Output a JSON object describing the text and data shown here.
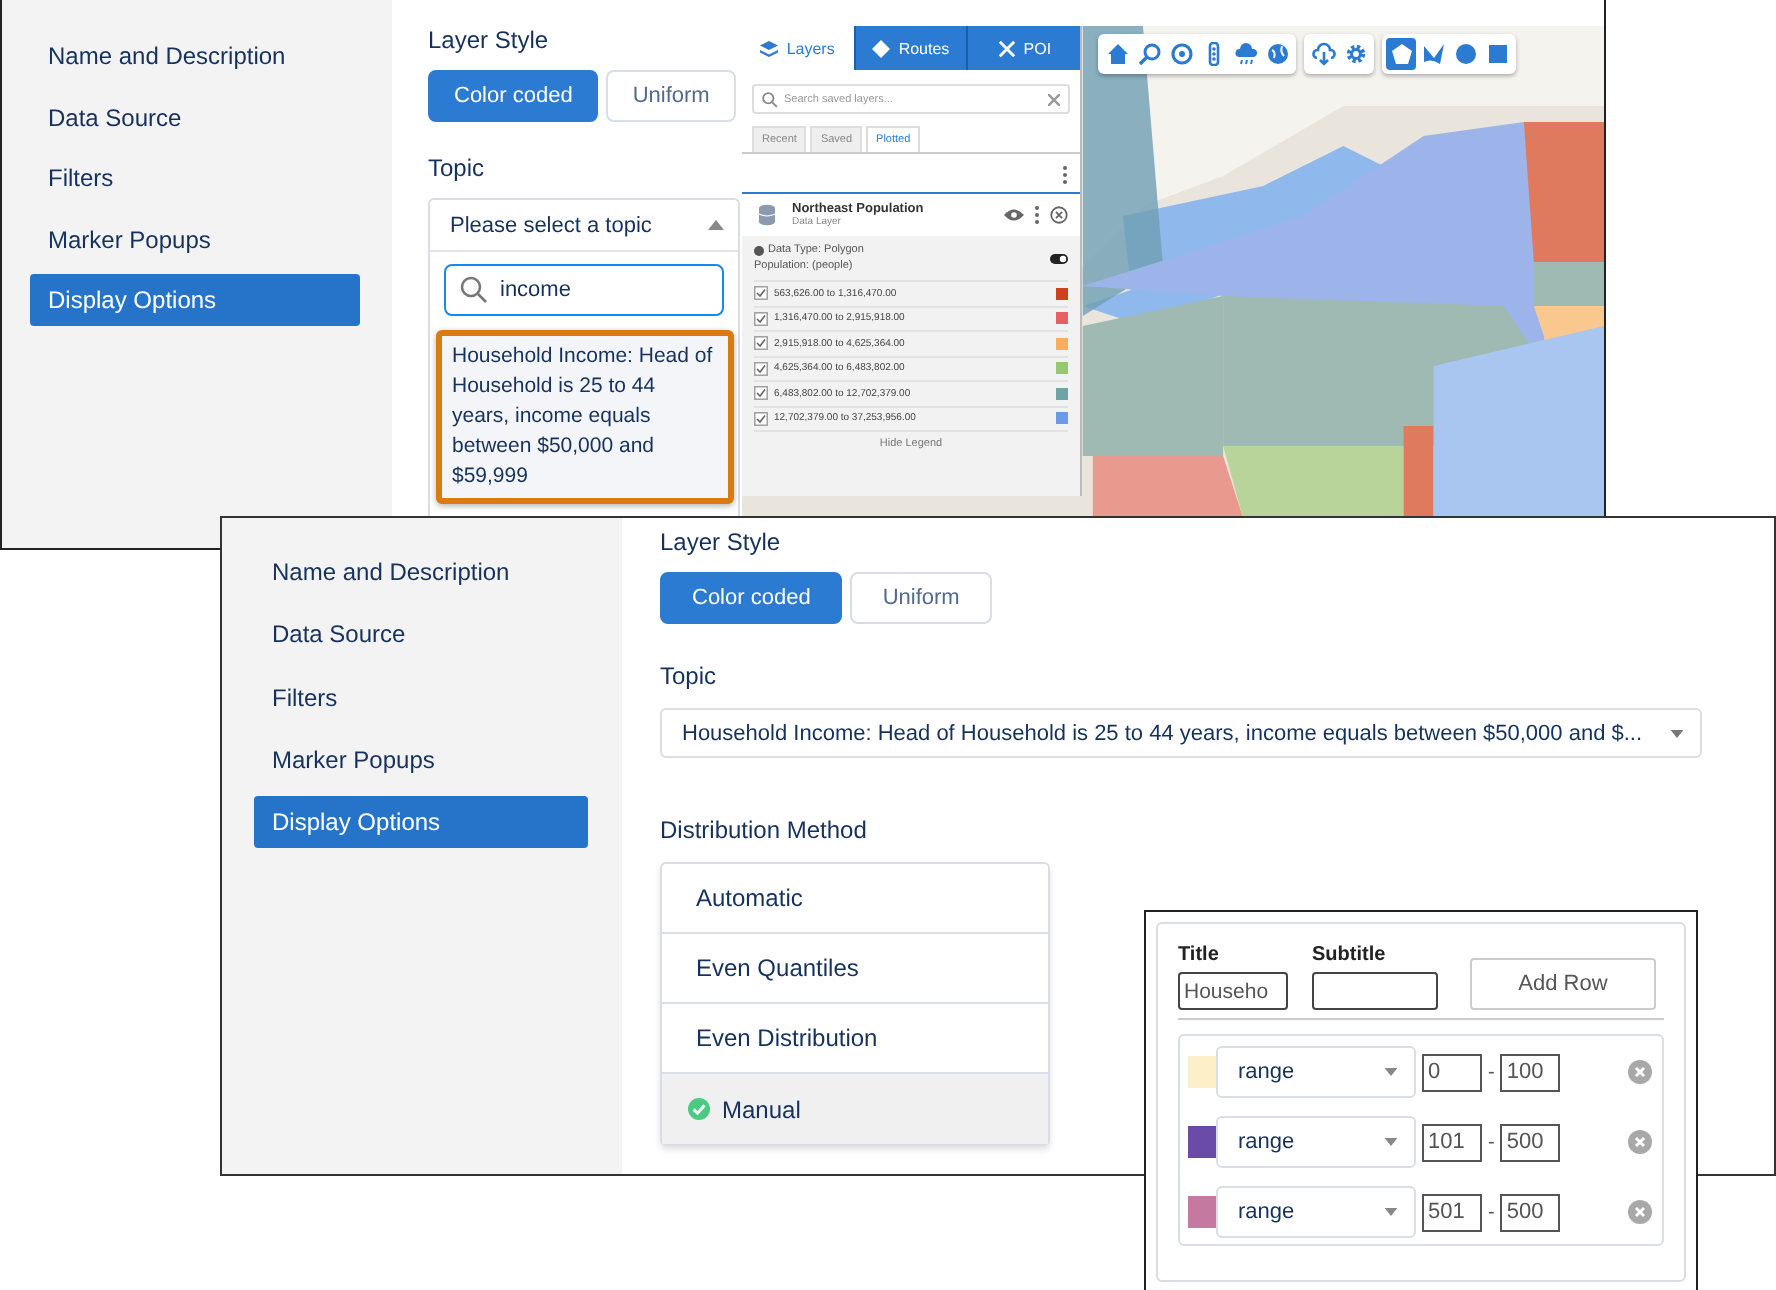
{
  "top_panel": {
    "sidebar": [
      {
        "label": "Name and Description",
        "selected": false
      },
      {
        "label": "Data Source",
        "selected": false
      },
      {
        "label": "Filters",
        "selected": false
      },
      {
        "label": "Marker Popups",
        "selected": false
      },
      {
        "label": "Display Options",
        "selected": true
      }
    ],
    "layer_style": {
      "label": "Layer Style",
      "options": [
        {
          "label": "Color coded",
          "selected": true
        },
        {
          "label": "Uniform",
          "selected": false
        }
      ]
    },
    "topic": {
      "label": "Topic",
      "placeholder": "Please select a topic",
      "search_value": "income",
      "option": "Household Income: Head of Household is 25 to 44 years, income equals between $50,000 and $59,999"
    },
    "map": {
      "toolbar": [
        [
          {
            "kind": "home",
            "selected": false
          },
          {
            "kind": "zoom",
            "selected": false
          },
          {
            "kind": "target",
            "selected": false
          },
          {
            "kind": "traffic",
            "selected": false
          },
          {
            "kind": "weather",
            "selected": false
          },
          {
            "kind": "globe",
            "selected": false
          }
        ],
        [
          {
            "kind": "download",
            "selected": false
          },
          {
            "kind": "settings",
            "selected": false
          }
        ],
        [
          {
            "kind": "polygon",
            "selected": true
          },
          {
            "kind": "lasso",
            "selected": false
          },
          {
            "kind": "circle",
            "selected": false
          },
          {
            "kind": "square",
            "selected": false
          }
        ]
      ],
      "layer_panel": {
        "tabs": [
          {
            "label": "Layers",
            "selected": true
          },
          {
            "label": "Routes",
            "selected": false
          },
          {
            "label": "POI",
            "selected": false
          }
        ],
        "search_placeholder": "Search saved layers...",
        "subtabs": [
          {
            "label": "Recent",
            "selected": false
          },
          {
            "label": "Saved",
            "selected": false
          },
          {
            "label": "Plotted",
            "selected": true
          }
        ],
        "layer": {
          "name": "Northeast Population",
          "subtitle": "Data Layer",
          "data_type": "Data Type: Polygon",
          "measure": "Population: (people)"
        },
        "legend": [
          {
            "label": "563,626.00 to 1,316,470.00",
            "checked": true,
            "color": "#d0401f"
          },
          {
            "label": "1,316,470.00 to 2,915,918.00",
            "checked": true,
            "color": "#e86060"
          },
          {
            "label": "2,915,918.00 to 4,625,364.00",
            "checked": true,
            "color": "#f8ae5c"
          },
          {
            "label": "4,625,364.00 to 6,483,802.00",
            "checked": true,
            "color": "#94c970"
          },
          {
            "label": "6,483,802.00 to 12,702,379.00",
            "checked": true,
            "color": "#6fa3a6"
          },
          {
            "label": "12,702,379.00 to 37,253,956.00",
            "checked": true,
            "color": "#6a9ae8"
          }
        ],
        "hide_legend": "Hide Legend"
      }
    }
  },
  "bottom_panel": {
    "sidebar": [
      {
        "label": "Name and Description",
        "selected": false
      },
      {
        "label": "Data Source",
        "selected": false
      },
      {
        "label": "Filters",
        "selected": false
      },
      {
        "label": "Marker Popups",
        "selected": false
      },
      {
        "label": "Display Options",
        "selected": true
      }
    ],
    "layer_style": {
      "label": "Layer Style",
      "options": [
        {
          "label": "Color coded",
          "selected": true
        },
        {
          "label": "Uniform",
          "selected": false
        }
      ]
    },
    "topic": {
      "label": "Topic",
      "value": "Household Income: Head of Household is 25 to 44 years, income equals between $50,000 and $..."
    },
    "distribution": {
      "label": "Distribution Method",
      "options": [
        {
          "label": "Automatic",
          "selected": false
        },
        {
          "label": "Even Quantiles",
          "selected": false
        },
        {
          "label": "Even Distribution",
          "selected": false
        },
        {
          "label": "Manual",
          "selected": true
        }
      ]
    }
  },
  "legend_editor": {
    "title_label": "Title",
    "title_value": "Househo",
    "subtitle_label": "Subtitle",
    "add_row": "Add Row",
    "rows": [
      {
        "color": "#fdf0c8",
        "type": "range",
        "from": "0",
        "separator": "-",
        "to": "100"
      },
      {
        "color": "#6a4ca8",
        "type": "range",
        "from": "101",
        "separator": "-",
        "to": "500"
      },
      {
        "color": "#c47aa0",
        "type": "range",
        "from": "501",
        "separator": "-",
        "to": "500"
      }
    ]
  }
}
